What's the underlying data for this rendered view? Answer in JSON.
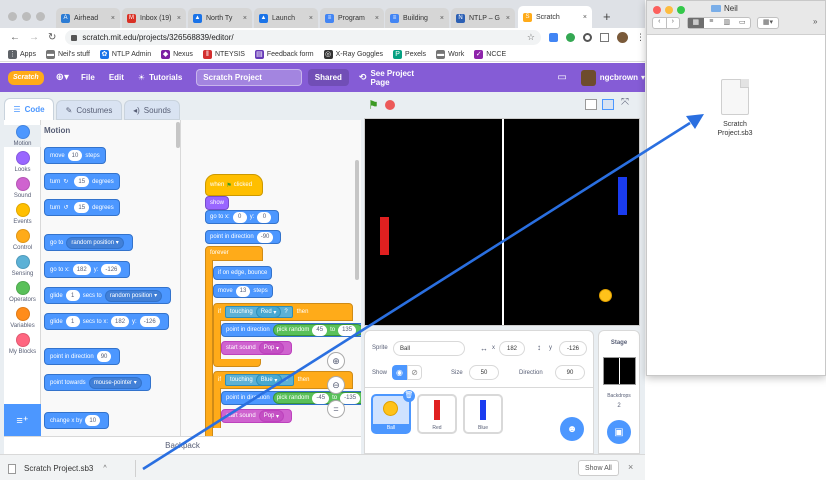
{
  "browser": {
    "tabs": [
      {
        "label": "Airhead",
        "color": "#2b7bd4",
        "glyph": "A"
      },
      {
        "label": "Inbox (19)",
        "color": "#d93025",
        "glyph": "M"
      },
      {
        "label": "North Ty",
        "color": "#1a73e8",
        "glyph": "▲"
      },
      {
        "label": "Launch",
        "color": "#1a73e8",
        "glyph": "▲"
      },
      {
        "label": "Program",
        "color": "#4285f4",
        "glyph": "≡"
      },
      {
        "label": "Building",
        "color": "#4285f4",
        "glyph": "≡"
      },
      {
        "label": "NTLP – G",
        "color": "#2b5fb4",
        "glyph": "N"
      },
      {
        "label": "Scratch",
        "color": "#ffab19",
        "glyph": "S"
      }
    ],
    "url": "scratch.mit.edu/projects/326568839/editor/",
    "bookmarks": [
      {
        "label": "Apps",
        "color": "#5f6368",
        "glyph": "⋮"
      },
      {
        "label": "Neil's stuff",
        "color": "#757575",
        "glyph": "▬"
      },
      {
        "label": "NTLP Admin",
        "color": "#1a73e8",
        "glyph": "✿"
      },
      {
        "label": "Nexus",
        "color": "#7b1fa2",
        "glyph": "◆"
      },
      {
        "label": "NTEYSIS",
        "color": "#d32f2f",
        "glyph": "‖"
      },
      {
        "label": "Feedback form",
        "color": "#673ab7",
        "glyph": "▤"
      },
      {
        "label": "X-Ray Goggles",
        "color": "#333333",
        "glyph": "◎"
      },
      {
        "label": "Pexels",
        "color": "#05a081",
        "glyph": "P"
      },
      {
        "label": "Work",
        "color": "#757575",
        "glyph": "▬"
      },
      {
        "label": "NCCE",
        "color": "#8e24aa",
        "glyph": "✓"
      }
    ]
  },
  "scratch": {
    "logo": "Scratch",
    "menu": {
      "file": "File",
      "edit": "Edit",
      "tutorials": "Tutorials",
      "project_title": "Scratch Project",
      "shared": "Shared",
      "see_project": "See Project Page",
      "user": "ngcbrown"
    },
    "tabs": {
      "code": "Code",
      "costumes": "Costumes",
      "sounds": "Sounds"
    },
    "categories": [
      {
        "label": "Motion",
        "color": "#4c97ff"
      },
      {
        "label": "Looks",
        "color": "#9966ff"
      },
      {
        "label": "Sound",
        "color": "#cf63cf"
      },
      {
        "label": "Events",
        "color": "#ffbf00"
      },
      {
        "label": "Control",
        "color": "#ffab19"
      },
      {
        "label": "Sensing",
        "color": "#5cb1d6"
      },
      {
        "label": "Operators",
        "color": "#59c059"
      },
      {
        "label": "Variables",
        "color": "#ff8c1a"
      },
      {
        "label": "My Blocks",
        "color": "#ff6680"
      }
    ],
    "palette": {
      "heading": "Motion",
      "move": {
        "a": "move",
        "v": "10",
        "b": "steps"
      },
      "turn_r": {
        "a": "turn",
        "v": "15",
        "b": "degrees"
      },
      "turn_l": {
        "a": "turn",
        "v": "15",
        "b": "degrees"
      },
      "goto": {
        "a": "go to",
        "d": "random position"
      },
      "gotoxy": {
        "a": "go to x:",
        "x": "182",
        "yl": "y:",
        "y": "-126"
      },
      "glide1": {
        "a": "glide",
        "v": "1",
        "b": "secs to",
        "d": "random position"
      },
      "glide2": {
        "a": "glide",
        "v": "1",
        "b": "secs to x:",
        "x": "182",
        "yl": "y:",
        "y": "-126"
      },
      "pointdir": {
        "a": "point in direction",
        "v": "90"
      },
      "pointtowards": {
        "a": "point towards",
        "d": "mouse-pointer"
      },
      "changex": {
        "a": "change x by",
        "v": "10"
      }
    },
    "script": {
      "hat": "when",
      "hat2": "clicked",
      "show": "show",
      "goto": {
        "a": "go to x:",
        "x": "0",
        "yl": "y:",
        "y": "0"
      },
      "point": {
        "a": "point in direction",
        "v": "-90"
      },
      "forever": "forever",
      "bounce": "if on edge, bounce",
      "move": {
        "a": "move",
        "v": "13",
        "b": "steps"
      },
      "if1": {
        "a": "if",
        "t": "touching",
        "d": "Red",
        "q": "?",
        "then": "then"
      },
      "pdir1": {
        "a": "point in direction",
        "r": "pick random",
        "v1": "45",
        "to": "to",
        "v2": "135"
      },
      "sound1": {
        "a": "start sound",
        "d": "Pop"
      },
      "if2": {
        "a": "if",
        "t": "touching",
        "d": "Blue",
        "q": "?",
        "then": "then"
      },
      "pdir2": {
        "a": "point in direction",
        "r": "pick random",
        "v1": "-45",
        "to": "to",
        "v2": "-135"
      },
      "sound2": {
        "a": "start sound",
        "d": "Pop"
      }
    },
    "backpack": "Backpack",
    "sprite_info": {
      "sprite_label": "Sprite",
      "sprite_name": "Ball",
      "x_label": "x",
      "x": "182",
      "y_label": "y",
      "y": "-126",
      "show_label": "Show",
      "size_label": "Size",
      "size": "50",
      "direction_label": "Direction",
      "direction": "90"
    },
    "sprites": [
      {
        "name": "Ball",
        "selected": true
      },
      {
        "name": "Red",
        "selected": false
      },
      {
        "name": "Blue",
        "selected": false
      }
    ],
    "stage_panel": {
      "title": "Stage",
      "backdrops_label": "Backdrops",
      "backdrops_count": "2"
    }
  },
  "finder": {
    "folder": "Neil",
    "file": "Scratch Project.sb3"
  },
  "download_bar": {
    "file": "Scratch Project.sb3",
    "show_all": "Show All"
  },
  "colors": {
    "scratch_blue": "#4c97ff",
    "scratch_purple": "#855cd6",
    "chrome_tab": "#dee1e6",
    "red_paddle": "#e02020",
    "blue_paddle": "#1a3cf0",
    "ball": "#ffc21a",
    "arrow": "#2a6fe0"
  }
}
